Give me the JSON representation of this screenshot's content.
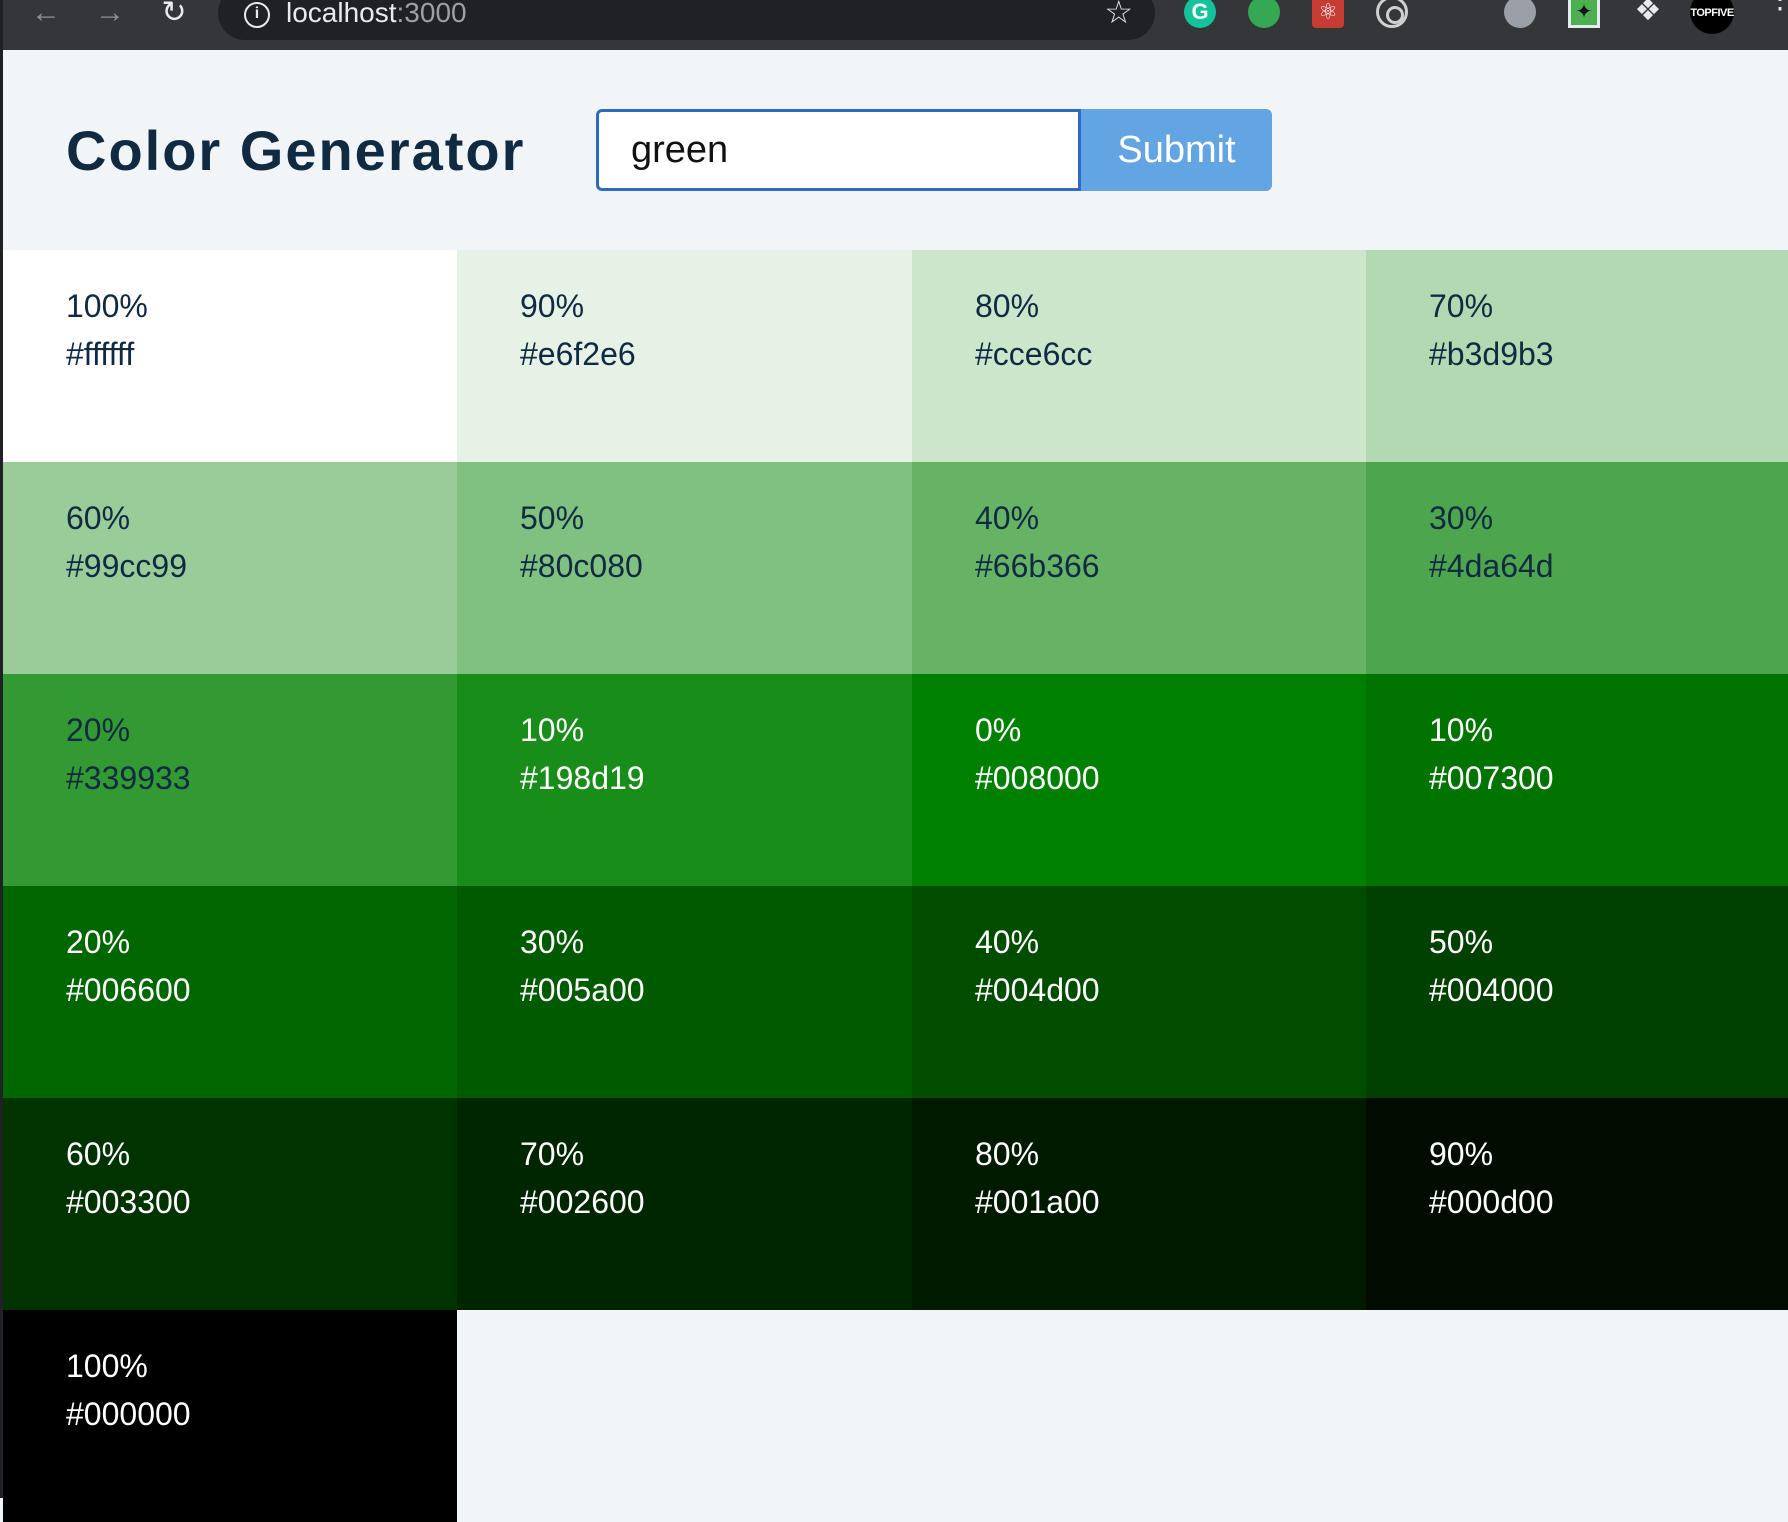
{
  "browser": {
    "url_host": "localhost",
    "url_port": ":3000",
    "icons": {
      "back": "arrow-left-icon",
      "forward": "arrow-right-icon",
      "reload": "reload-icon",
      "info": "info-icon",
      "bookmark": "star-icon",
      "menu": "kebab-menu-icon"
    },
    "extensions": {
      "topfive_label": "TOPFIVE"
    }
  },
  "header": {
    "title": "Color Generator",
    "input_value": "green",
    "submit_label": "Submit"
  },
  "colors": {
    "text_dark": "#102a42",
    "text_light": "#ffffff",
    "page_bg": "#f1f5f8",
    "button_bg": "#63a4e3",
    "input_border": "#2d6ac1"
  },
  "swatches": [
    {
      "percent": "100%",
      "hex": "#ffffff",
      "tone": "light"
    },
    {
      "percent": "90%",
      "hex": "#e6f2e6",
      "tone": "light"
    },
    {
      "percent": "80%",
      "hex": "#cce6cc",
      "tone": "light"
    },
    {
      "percent": "70%",
      "hex": "#b3d9b3",
      "tone": "light"
    },
    {
      "percent": "60%",
      "hex": "#99cc99",
      "tone": "light"
    },
    {
      "percent": "50%",
      "hex": "#80c080",
      "tone": "light"
    },
    {
      "percent": "40%",
      "hex": "#66b366",
      "tone": "light"
    },
    {
      "percent": "30%",
      "hex": "#4da64d",
      "tone": "light"
    },
    {
      "percent": "20%",
      "hex": "#339933",
      "tone": "light"
    },
    {
      "percent": "10%",
      "hex": "#198d19",
      "tone": "dark"
    },
    {
      "percent": "0%",
      "hex": "#008000",
      "tone": "dark"
    },
    {
      "percent": "10%",
      "hex": "#007300",
      "tone": "dark"
    },
    {
      "percent": "20%",
      "hex": "#006600",
      "tone": "dark"
    },
    {
      "percent": "30%",
      "hex": "#005a00",
      "tone": "dark"
    },
    {
      "percent": "40%",
      "hex": "#004d00",
      "tone": "dark"
    },
    {
      "percent": "50%",
      "hex": "#004000",
      "tone": "dark"
    },
    {
      "percent": "60%",
      "hex": "#003300",
      "tone": "dark"
    },
    {
      "percent": "70%",
      "hex": "#002600",
      "tone": "dark"
    },
    {
      "percent": "80%",
      "hex": "#001a00",
      "tone": "dark"
    },
    {
      "percent": "90%",
      "hex": "#000d00",
      "tone": "dark"
    },
    {
      "percent": "100%",
      "hex": "#000000",
      "tone": "dark"
    }
  ]
}
